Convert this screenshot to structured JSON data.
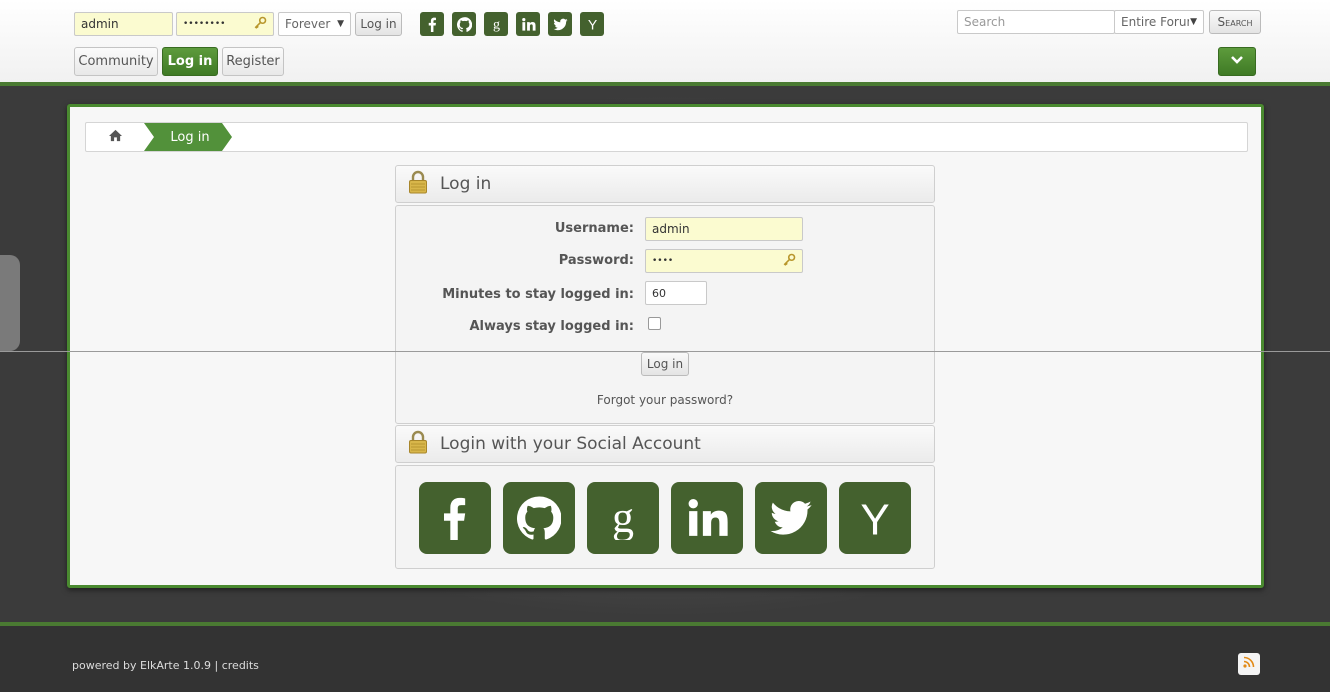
{
  "header": {
    "quick_login": {
      "username_value": "admin",
      "password_mask": "••••••••",
      "duration_selected": "Forever",
      "login_label": "Log in"
    },
    "social_icons": [
      "facebook-icon",
      "github-icon",
      "google-icon",
      "linkedin-icon",
      "twitter-icon",
      "yahoo-icon"
    ],
    "search": {
      "placeholder": "Search",
      "scope_selected": "Entire Forum",
      "button_label": "Search"
    },
    "menu": [
      {
        "label": "Community",
        "active": false
      },
      {
        "label": "Log in",
        "active": true
      },
      {
        "label": "Register",
        "active": false
      }
    ]
  },
  "breadcrumb": {
    "current": "Log in"
  },
  "login_box": {
    "title": "Log in",
    "username_label": "Username:",
    "username_value": "admin",
    "password_label": "Password:",
    "password_mask": "••••",
    "minutes_label": "Minutes to stay logged in:",
    "minutes_value": "60",
    "always_label": "Always stay logged in:",
    "always_checked": false,
    "submit_label": "Log in",
    "forgot_label": "Forgot your password?"
  },
  "social_box": {
    "title": "Login with your Social Account",
    "icons": [
      "facebook-icon",
      "github-icon",
      "google-icon",
      "linkedin-icon",
      "twitter-icon",
      "yahoo-icon"
    ]
  },
  "footer": {
    "powered_by": "powered by",
    "product": "ElkArte 1.0.9",
    "separator": "|",
    "credits": "credits"
  },
  "colors": {
    "accent_green": "#4a7a32",
    "social_green": "#44612e",
    "autofill_yellow": "#fbfbd0"
  }
}
